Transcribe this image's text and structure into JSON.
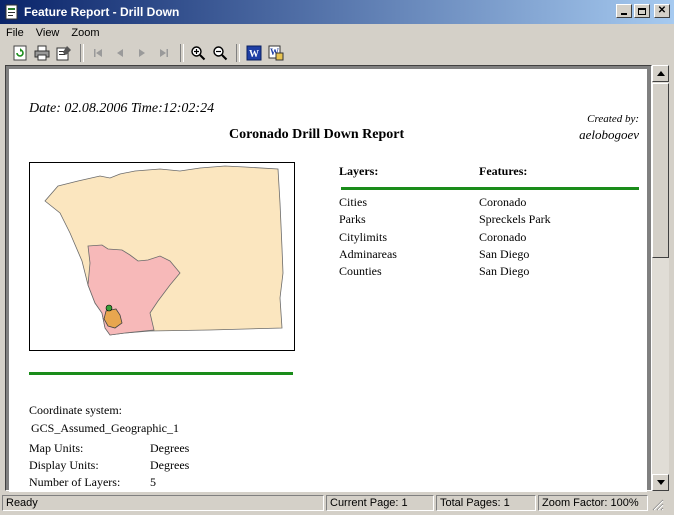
{
  "window": {
    "title": "Feature Report - Drill Down"
  },
  "menu": [
    "File",
    "View",
    "Zoom"
  ],
  "toolbar": {
    "buttons": [
      "refresh-icon",
      "print-icon",
      "page-setup-icon",
      "first-page-icon",
      "prev-page-icon",
      "next-page-icon",
      "last-page-icon",
      "zoom-in-icon",
      "zoom-out-icon",
      "export-word-icon",
      "export-wordpad-icon"
    ]
  },
  "report": {
    "date_line": "Date: 02.08.2006 Time:12:02:24",
    "created_by_label": "Created by:",
    "created_by_name": "aelobogoev",
    "title": "Coronado Drill Down Report",
    "layers_header": "Layers:",
    "features_header": "Features:",
    "rows": [
      {
        "layer": "Cities",
        "feature": "Coronado"
      },
      {
        "layer": "Parks",
        "feature": "Spreckels Park"
      },
      {
        "layer": "Citylimits",
        "feature": "Coronado"
      },
      {
        "layer": "Adminareas",
        "feature": "San Diego"
      },
      {
        "layer": "Counties",
        "feature": "San Diego"
      }
    ],
    "coord_label": "Coordinate system:",
    "coord_value": "GCS_Assumed_Geographic_1",
    "map_units_label": "Map Units:",
    "map_units_value": "Degrees",
    "display_units_label": "Display Units:",
    "display_units_value": "Degrees",
    "num_layers_label": "Number of Layers:",
    "num_layers_value": "5"
  },
  "map_colors": {
    "county": "#fbe6bf",
    "adminarea": "#f7b9b9",
    "city": "#e8a64f",
    "border": "#6b6b6b"
  },
  "status": {
    "ready": "Ready",
    "current_page": "Current Page: 1",
    "total_pages": "Total Pages: 1",
    "zoom": "Zoom Factor: 100%"
  }
}
